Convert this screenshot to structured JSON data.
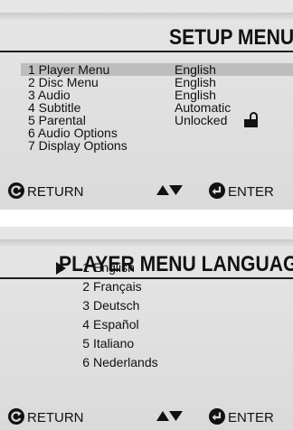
{
  "setup_menu": {
    "title": "SETUP MENU",
    "items": [
      {
        "label": "1 Player Menu",
        "value": "English",
        "selected": true
      },
      {
        "label": "2 Disc Menu",
        "value": "English"
      },
      {
        "label": "3 Audio",
        "value": "English"
      },
      {
        "label": "4 Subtitle",
        "value": "Automatic"
      },
      {
        "label": "5 Parental",
        "value": "Unlocked",
        "icon": "unlocked-padlock-icon"
      },
      {
        "label": "6 Audio Options",
        "value": ""
      },
      {
        "label": "7 Display Options",
        "value": ""
      }
    ],
    "footer": {
      "return_label": "RETURN",
      "return_icon": "return-arrow-circle-icon",
      "nav_icon": "up-down-triangle-icon",
      "enter_icon": "enter-arrow-circle-icon",
      "enter_label": "ENTER"
    }
  },
  "player_menu_language": {
    "title": "PLAYER MENU LANGUAGE",
    "pointer_icon": "right-triangle-pointer-icon",
    "languages": [
      {
        "num": "1",
        "name": "English",
        "selected": true
      },
      {
        "num": "2",
        "name": "Français"
      },
      {
        "num": "3",
        "name": "Deutsch"
      },
      {
        "num": "4",
        "name": "Español"
      },
      {
        "num": "5",
        "name": "Italiano"
      },
      {
        "num": "6",
        "name": "Nederlands"
      }
    ],
    "footer": {
      "return_label": "RETURN",
      "return_icon": "return-arrow-circle-icon",
      "nav_icon": "up-down-triangle-icon",
      "enter_icon": "enter-arrow-circle-icon",
      "enter_label": "ENTER"
    }
  },
  "colors": {
    "selection": "#bdbdbd",
    "panel": "#dadada",
    "text": "#111111"
  }
}
